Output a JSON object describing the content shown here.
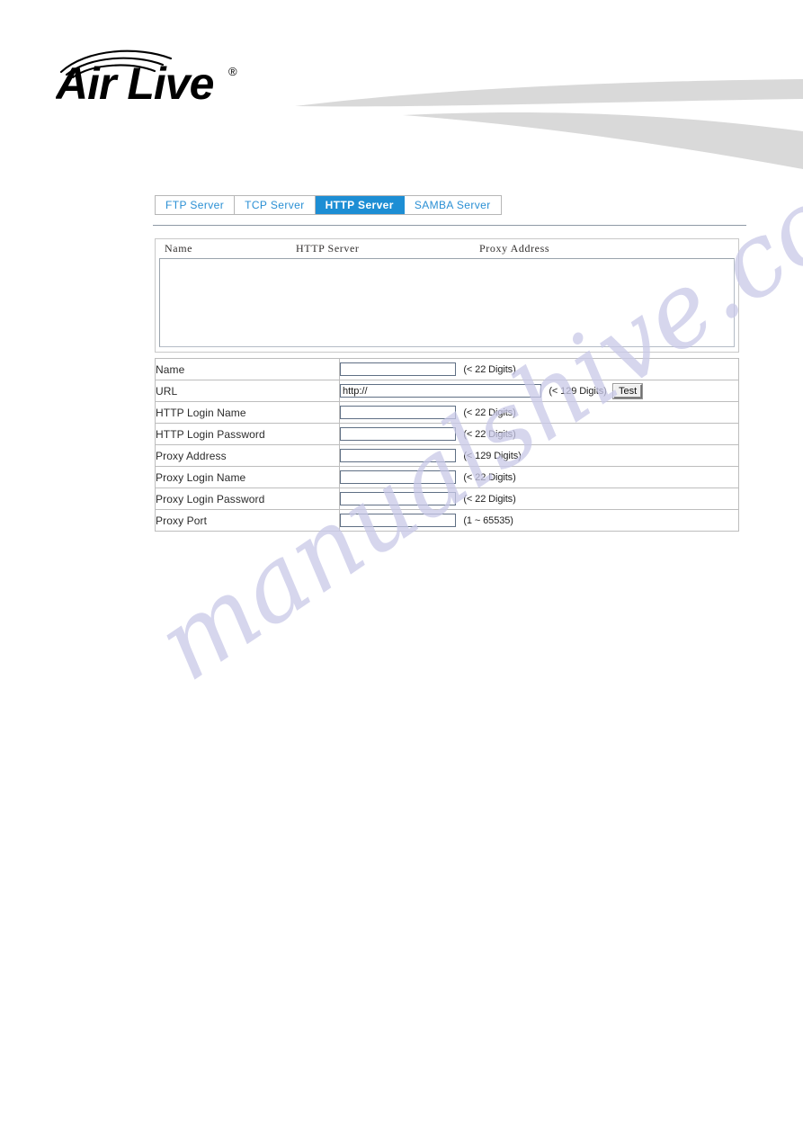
{
  "brand": {
    "logo_text_air": "Air",
    "logo_text_live": "Live",
    "registered_mark": "®",
    "logo_alt": "AirLive"
  },
  "watermark": {
    "text": "manualshive.com"
  },
  "tabs": [
    {
      "label": "FTP Server",
      "active": false
    },
    {
      "label": "TCP Server",
      "active": false
    },
    {
      "label": "HTTP Server",
      "active": true
    },
    {
      "label": "SAMBA Server",
      "active": false
    }
  ],
  "list_panel": {
    "columns": [
      "Name",
      "HTTP Server",
      "Proxy Address"
    ],
    "rows": []
  },
  "form": {
    "rows": [
      {
        "label": "Name",
        "value": "",
        "placeholder": "",
        "hint": "(< 22 Digits)",
        "width": "short",
        "button": null
      },
      {
        "label": "URL",
        "value": "http://",
        "placeholder": "",
        "hint": "(< 129 Digits)",
        "width": "long",
        "button": "Test"
      },
      {
        "label": "HTTP Login Name",
        "value": "",
        "placeholder": "",
        "hint": "(< 22 Digits)",
        "width": "short",
        "button": null
      },
      {
        "label": "HTTP Login Password",
        "value": "",
        "placeholder": "",
        "hint": "(< 22 Digits)",
        "width": "short",
        "button": null
      },
      {
        "label": "Proxy Address",
        "value": "",
        "placeholder": "",
        "hint": "(< 129 Digits)",
        "width": "short",
        "button": null
      },
      {
        "label": "Proxy Login Name",
        "value": "",
        "placeholder": "",
        "hint": "(< 22 Digits)",
        "width": "short",
        "button": null
      },
      {
        "label": "Proxy Login Password",
        "value": "",
        "placeholder": "",
        "hint": "(< 22 Digits)",
        "width": "short",
        "button": null
      },
      {
        "label": "Proxy Port",
        "value": "",
        "placeholder": "",
        "hint": "(1 ~ 65535)",
        "width": "short",
        "button": null
      }
    ]
  },
  "colors": {
    "tab_active_bg": "#1d8ed4",
    "tab_inactive_text": "#2a8fd4",
    "swoosh_gray": "#d9d9d9",
    "watermark": "#c9c9e8",
    "input_border": "#5f6f84"
  }
}
